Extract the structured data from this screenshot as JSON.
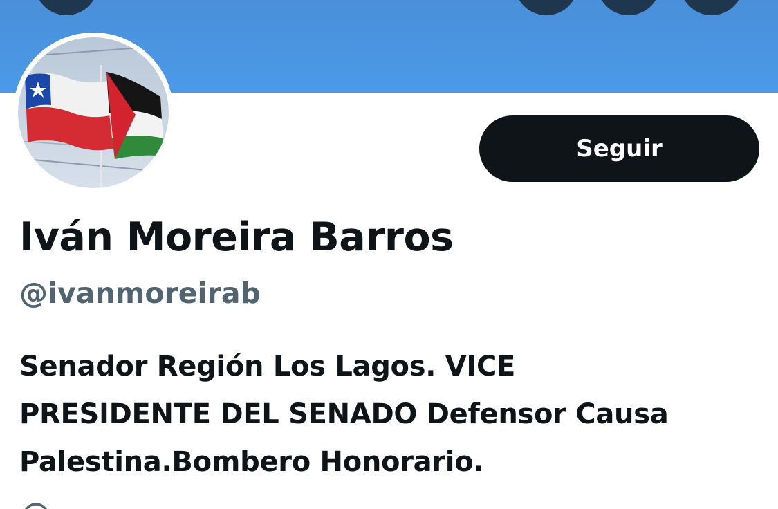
{
  "profile": {
    "follow_label": "Seguir",
    "display_name": "Iván Moreira Barros",
    "handle": "@ivanmoreirab",
    "bio_lines": [
      "Senador Región Los Lagos. VICE",
      "PRESIDENTE DEL SENADO Defensor Causa",
      "Palestina.Bombero Honorario."
    ]
  },
  "banner": {
    "color": "#4b9ae8",
    "buttons": [
      {
        "icon": "back-arrow-icon"
      },
      {
        "icon": "search-icon"
      },
      {
        "icon": "notifications-icon"
      },
      {
        "icon": "more-icon"
      }
    ]
  },
  "avatar": {
    "description_icons": [
      "chile-flag",
      "palestine-flag"
    ]
  },
  "colors": {
    "primary_text": "#0f1419",
    "secondary_text": "#536471",
    "link": "#1d9bf0",
    "button_bg": "#0f1419"
  }
}
